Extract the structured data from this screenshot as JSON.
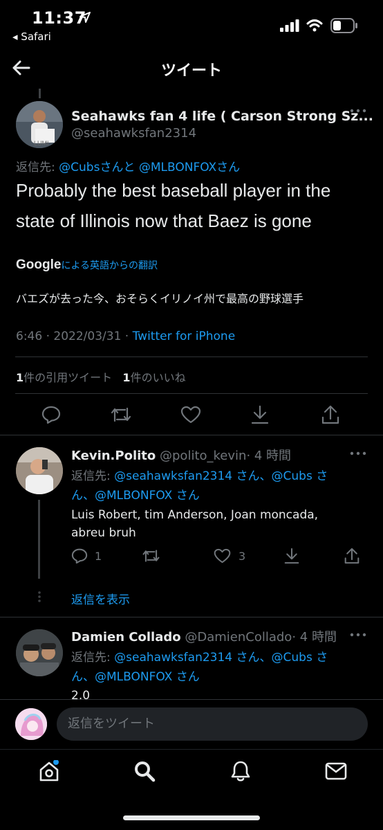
{
  "status_bar": {
    "time": "11:37",
    "back_app": "◂ Safari"
  },
  "header": {
    "title": "ツイート"
  },
  "main_tweet": {
    "display_name": "Seahawks fan 4 life ( Carson Strong Sz...",
    "handle": "@seahawksfan2314",
    "reply_prefix": "返信先: ",
    "reply_cubs": "@Cubs",
    "reply_and": "さんと",
    "reply_mlbonfox": "@MLBONFOX",
    "reply_san": "さん",
    "text_line1": "Probably the best baseball player in the",
    "text_line2": "state of Illinois now that Baez is gone",
    "google_logo": "Google",
    "translation_label": "による英語からの翻訳",
    "translation_text": "バエズが去った今、おそらくイリノイ州で最高の野球選手",
    "time": "6:46",
    "date": "2022/03/31",
    "source": "Twitter for iPhone",
    "sep": "·",
    "quote_count": "1",
    "quote_label": "件の引用ツイート",
    "like_count": "1",
    "like_label": "件のいいね",
    "avatar_sign": "LUMI"
  },
  "replies": [
    {
      "display_name": "Kevin.Polito",
      "handle": "@polito_kevin",
      "age": "· 4 時間",
      "reply_prefix": "返信先: ",
      "reply_line1_mention": "@seahawksfan2314",
      "reply_line1_mid": " さん、",
      "reply_line1_cubs": "@Cubs",
      "reply_line1_end": " さ",
      "reply_line2_pre": "ん、",
      "reply_line2_mention": "@MLBONFOX",
      "reply_line2_end": " さん",
      "text_line1": "Luis Robert, tim Anderson, Joan moncada,",
      "text_line2": "abreu bruh",
      "reply_count": "1",
      "like_count": "3",
      "show_replies": "返信を表示"
    },
    {
      "display_name": "Damien Collado",
      "handle": "@DamienCollado",
      "age": "· 4 時間",
      "reply_prefix": "返信先: ",
      "reply_line1_mention": "@seahawksfan2314",
      "reply_line1_mid": " さん、",
      "reply_line1_cubs": "@Cubs",
      "reply_line1_end": " さ",
      "reply_line2_pre": "ん、",
      "reply_line2_mention": "@MLBONFOX",
      "reply_line2_end": " さん",
      "text_line1": "2.0"
    }
  ],
  "reply_bar": {
    "placeholder": "返信をツイート"
  },
  "colors": {
    "link": "#1d9bf0",
    "muted": "#71767b",
    "background": "#000000",
    "text": "#e7e9ea"
  },
  "icons": [
    "back-arrow-icon",
    "more-icon",
    "reply-icon",
    "retweet-icon",
    "like-icon",
    "bookmark-icon",
    "share-icon",
    "home-icon",
    "search-icon",
    "notifications-icon",
    "messages-icon"
  ]
}
